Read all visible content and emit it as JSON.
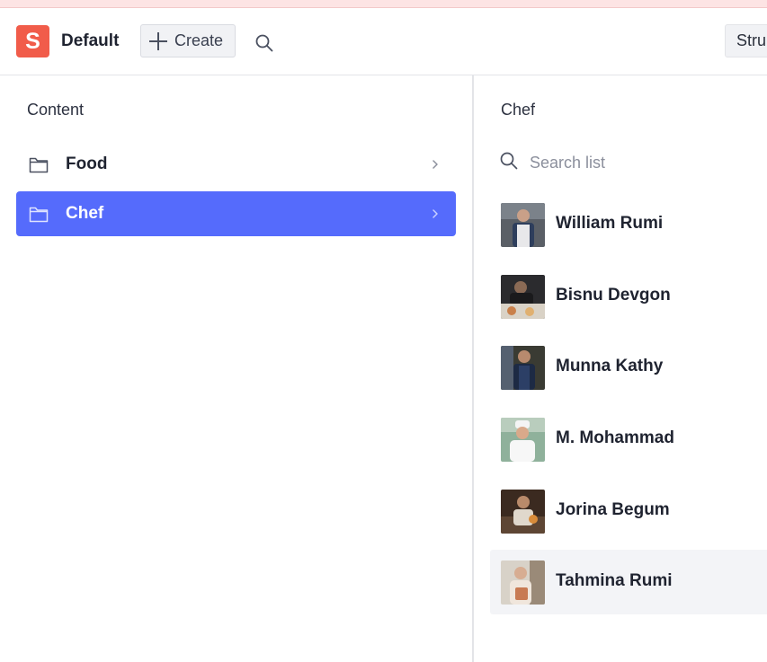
{
  "header": {
    "logo_letter": "S",
    "workspace": "Default",
    "create_label": "Create",
    "structure_label": "Stru"
  },
  "content_pane": {
    "title": "Content",
    "items": [
      {
        "label": "Food",
        "selected": false
      },
      {
        "label": "Chef",
        "selected": true
      }
    ]
  },
  "chef_pane": {
    "title": "Chef",
    "search_placeholder": "Search list",
    "items": [
      {
        "name": "William Rumi"
      },
      {
        "name": "Bisnu Devgon"
      },
      {
        "name": "Munna Kathy"
      },
      {
        "name": "M. Mohammad"
      },
      {
        "name": "Jorina Begum"
      },
      {
        "name": "Tahmina Rumi"
      }
    ]
  },
  "colors": {
    "brand": "#f15c4a",
    "selected": "#556bfc",
    "hover_row": "#f3f4f7"
  }
}
